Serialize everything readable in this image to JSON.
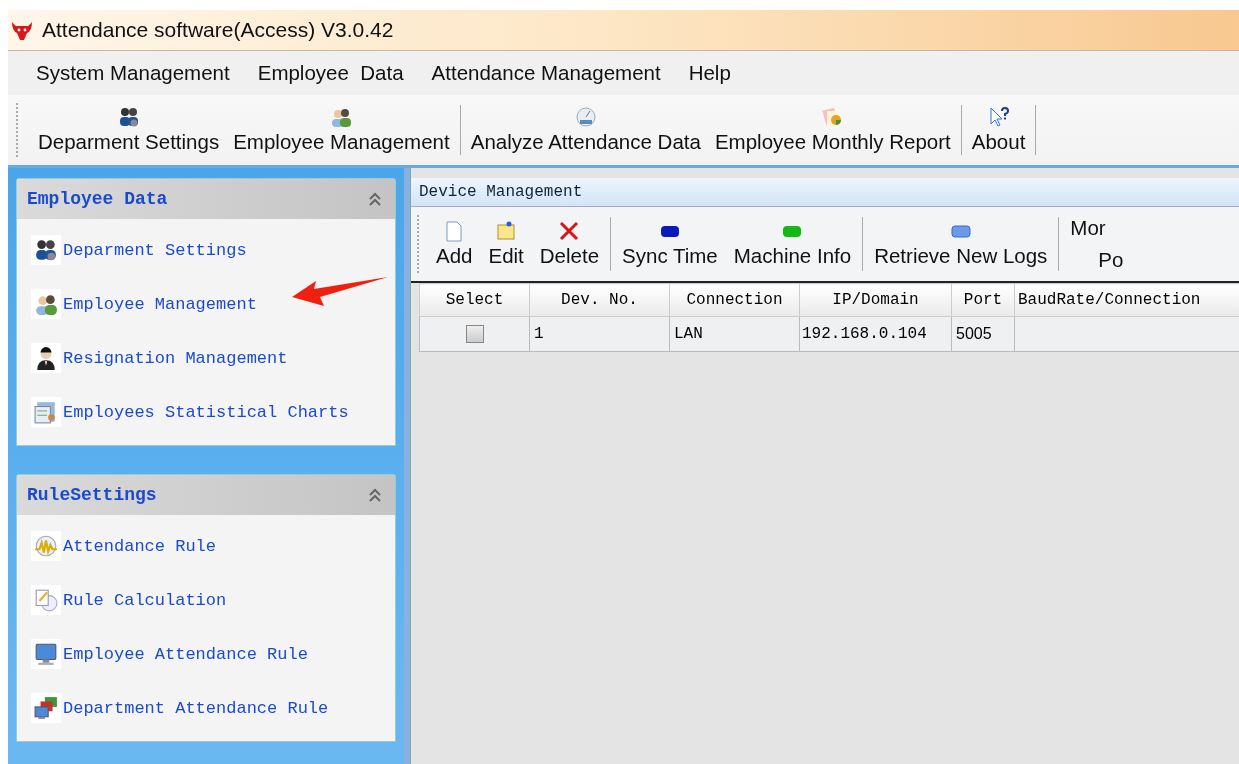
{
  "window": {
    "title": "Attendance software(Access) V3.0.42"
  },
  "menu": [
    "System Management",
    "Employee  Data",
    "Attendance Management",
    "Help"
  ],
  "toolbar": [
    {
      "label": "Deparment Settings",
      "separator_after": false
    },
    {
      "label": "Employee Management",
      "separator_after": true
    },
    {
      "label": "Analyze Attendance Data",
      "separator_after": false
    },
    {
      "label": "Employee Monthly Report",
      "separator_after": true
    },
    {
      "label": "About",
      "separator_after": true
    }
  ],
  "sidebar": [
    {
      "title": "Employee Data",
      "items": [
        "Deparment Settings",
        "Employee Management",
        "Resignation Management",
        "Employees Statistical Charts"
      ]
    },
    {
      "title": "RuleSettings",
      "items": [
        "Attendance Rule",
        "Rule Calculation",
        "Employee Attendance Rule",
        "Department Attendance Rule"
      ]
    }
  ],
  "device_panel": {
    "title": "Device Management",
    "toolbar": [
      {
        "label": "Add",
        "separator_after": false
      },
      {
        "label": "Edit",
        "separator_after": false
      },
      {
        "label": "Delete",
        "separator_after": true
      },
      {
        "label": "Sync Time",
        "separator_after": false
      },
      {
        "label": "Machine Info",
        "separator_after": true
      },
      {
        "label": "Retrieve New Logs",
        "separator_after": true
      }
    ],
    "toolbar_cut": [
      "Mor",
      "Po"
    ],
    "table": {
      "columns": [
        "Select",
        "Dev. No.",
        "Connection",
        "IP/Domain",
        "Port",
        "BaudRate/Connection"
      ],
      "rows": [
        {
          "checked": false,
          "cells": [
            "",
            "1",
            "LAN",
            "192.168.0.104",
            "5005",
            ""
          ]
        }
      ]
    }
  }
}
